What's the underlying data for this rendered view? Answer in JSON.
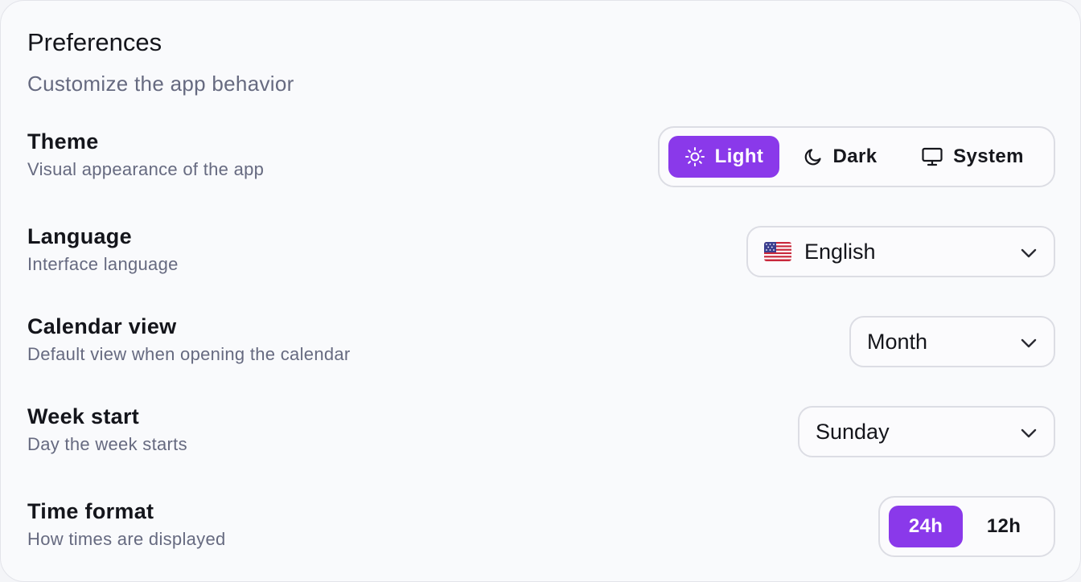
{
  "header": {
    "title": "Preferences",
    "subtitle": "Customize the app behavior"
  },
  "theme": {
    "label": "Theme",
    "description": "Visual appearance of the app",
    "options": [
      {
        "label": "Light",
        "icon": "sun-icon",
        "selected": true
      },
      {
        "label": "Dark",
        "icon": "moon-icon",
        "selected": false
      },
      {
        "label": "System",
        "icon": "monitor-icon",
        "selected": false
      }
    ]
  },
  "language": {
    "label": "Language",
    "description": "Interface language",
    "value": "English",
    "flag_icon": "us-flag-icon"
  },
  "calendar_view": {
    "label": "Calendar view",
    "description": "Default view when opening the calendar",
    "value": "Month"
  },
  "week_start": {
    "label": "Week start",
    "description": "Day the week starts",
    "value": "Sunday"
  },
  "time_format": {
    "label": "Time format",
    "description": "How times are displayed",
    "options": [
      {
        "label": "24h",
        "selected": true
      },
      {
        "label": "12h",
        "selected": false
      }
    ]
  },
  "colors": {
    "accent": "#8a39ea",
    "text": "#14151b",
    "muted": "#666a80",
    "border": "#dcdde4"
  }
}
